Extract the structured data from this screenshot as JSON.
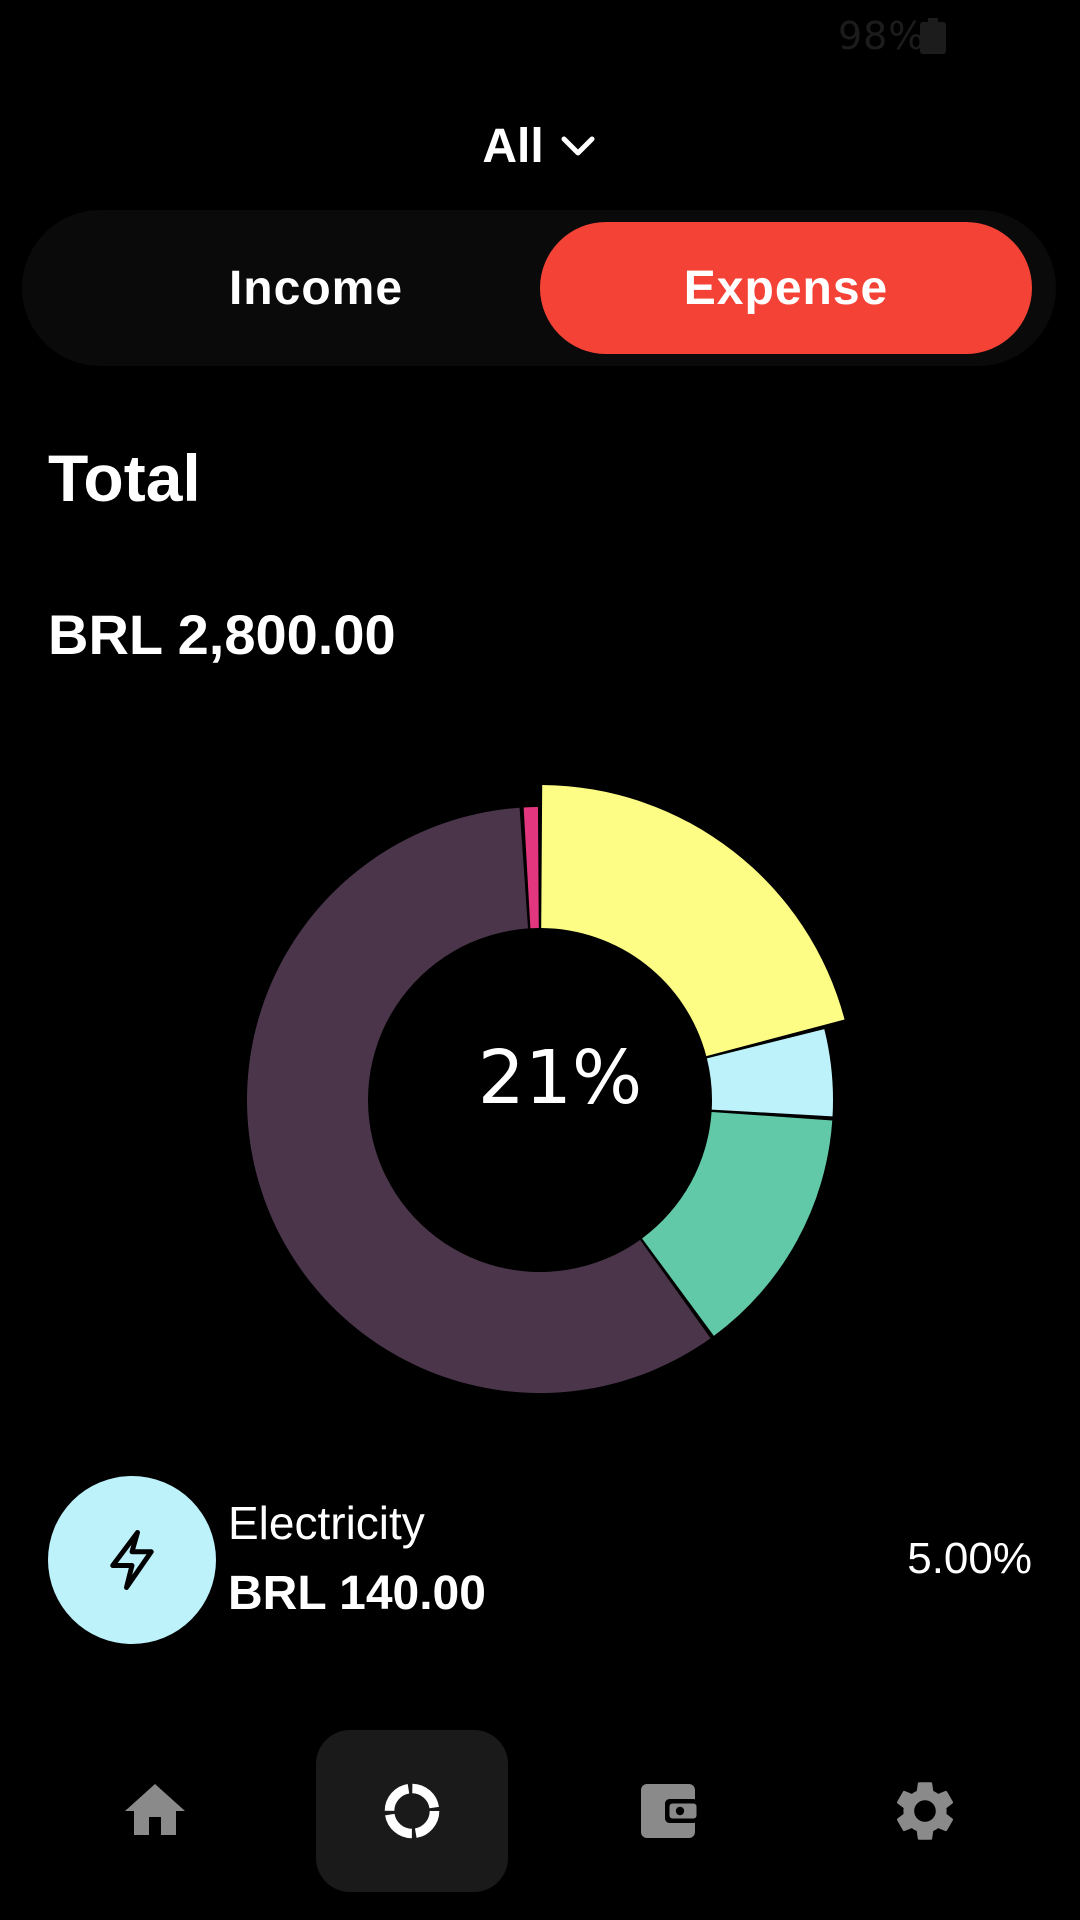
{
  "status_bar": {
    "battery": "98%"
  },
  "filter": {
    "label": "All"
  },
  "toggle": {
    "income_label": "Income",
    "expense_label": "Expense",
    "selected": "Expense"
  },
  "summary": {
    "title": "Total",
    "amount": "BRL 2,800.00"
  },
  "chart_data": {
    "type": "pie",
    "variant": "donut",
    "center_label": "21%",
    "slices": [
      {
        "value": 21,
        "color": "#fdfc85",
        "exploded": true
      },
      {
        "value": 5,
        "color": "#bdf2fb",
        "exploded": false
      },
      {
        "value": 14,
        "color": "#61c9a7",
        "exploded": false
      },
      {
        "value": 59,
        "color": "#4b354a",
        "exploded": false
      },
      {
        "value": 1,
        "color": "#e2377e",
        "exploded": false
      }
    ]
  },
  "selected_category": {
    "icon": "lightning-bolt-icon",
    "name": "Electricity",
    "amount": "BRL 140.00",
    "percent": "5.00%",
    "color": "#bdf2fb"
  },
  "nav": {
    "items": [
      {
        "icon": "home-icon"
      },
      {
        "icon": "donut-chart-icon",
        "active": true
      },
      {
        "icon": "wallet-icon"
      },
      {
        "icon": "gear-icon"
      }
    ]
  }
}
